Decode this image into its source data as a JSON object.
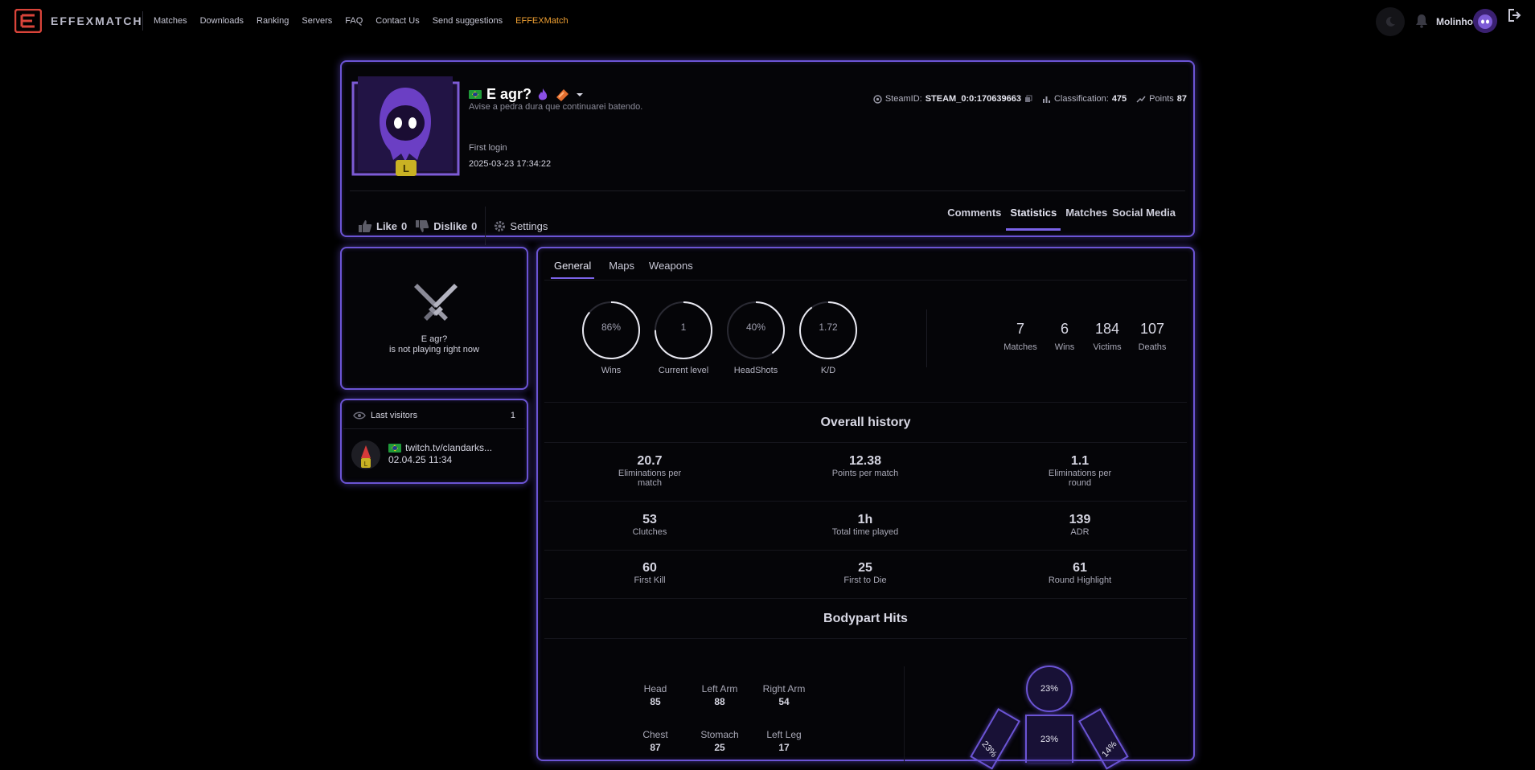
{
  "navbar": {
    "brand": "EFFEXMATCH",
    "links": [
      "Matches",
      "Downloads",
      "Ranking",
      "Servers",
      "FAQ",
      "Contact Us",
      "Send suggestions",
      "EFFEXMatch"
    ],
    "username": "Molinho",
    "accent_color": "#f0a032"
  },
  "profile": {
    "name": "E agr?",
    "bio": "Avise a pedra dura que continuarei batendo.",
    "level_badge": "L",
    "first_login_label": "First login",
    "first_login_value": "2025-03-23 17:34:22",
    "steam_label": "SteamID:",
    "steam_id": "STEAM_0:0:170639663",
    "classification_label": "Classification:",
    "classification_value": "475",
    "points_label": "Points",
    "points_value": "87",
    "like_label": "Like",
    "like_count": "0",
    "dislike_label": "Dislike",
    "dislike_count": "0",
    "settings_label": "Settings",
    "tabs": [
      "Comments",
      "Statistics",
      "Matches",
      "Social Media"
    ],
    "active_tab": "Statistics"
  },
  "status_card": {
    "name": "E agr?",
    "text": "is not playing right now"
  },
  "visitors": {
    "title": "Last visitors",
    "count": "1",
    "items": [
      {
        "name": "twitch.tv/clandarks...",
        "time": "02.04.25 11:34",
        "badge": "L"
      }
    ]
  },
  "stats": {
    "tabs": [
      "General",
      "Maps",
      "Weapons"
    ],
    "active_tab": "General",
    "rings": [
      {
        "value": "86%",
        "label": "Wins",
        "fraction": 0.86
      },
      {
        "value": "1",
        "label": "Current level",
        "fraction": 0.75
      },
      {
        "value": "40%",
        "label": "HeadShots",
        "fraction": 0.4
      },
      {
        "value": "1.72",
        "label": "K/D",
        "fraction": 0.9
      }
    ],
    "totals": [
      {
        "value": "7",
        "label": "Matches"
      },
      {
        "value": "6",
        "label": "Wins"
      },
      {
        "value": "184",
        "label": "Victims"
      },
      {
        "value": "107",
        "label": "Deaths"
      }
    ],
    "overall_title": "Overall history",
    "overall": [
      {
        "value": "20.7",
        "label": "Eliminations per match"
      },
      {
        "value": "12.38",
        "label": "Points per match"
      },
      {
        "value": "1.1",
        "label": "Eliminations per round"
      },
      {
        "value": "53",
        "label": "Clutches"
      },
      {
        "value": "1h",
        "label": "Total time played"
      },
      {
        "value": "139",
        "label": "ADR"
      },
      {
        "value": "60",
        "label": "First Kill"
      },
      {
        "value": "25",
        "label": "First to Die"
      },
      {
        "value": "61",
        "label": "Round Highlight"
      }
    ],
    "bodypart_title": "Bodypart Hits",
    "bodyparts": [
      {
        "label": "Head",
        "value": "85"
      },
      {
        "label": "Left Arm",
        "value": "88"
      },
      {
        "label": "Right Arm",
        "value": "54"
      },
      {
        "label": "Chest",
        "value": "87"
      },
      {
        "label": "Stomach",
        "value": "25"
      },
      {
        "label": "Left Leg",
        "value": "17"
      }
    ],
    "figure": {
      "head": "23%",
      "chest": "23%",
      "left_arm": "23%",
      "right_arm": "14%"
    }
  }
}
